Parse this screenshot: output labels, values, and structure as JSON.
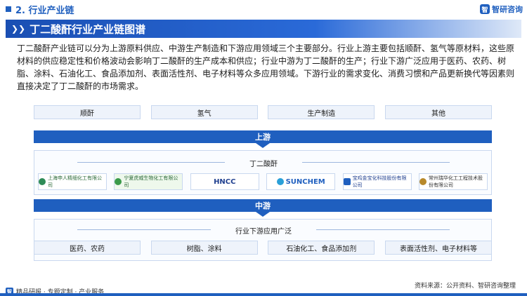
{
  "header": {
    "section": "2. 行业产业链",
    "brand": "智研咨询"
  },
  "title": "丁二酸酐行业产业链图谱",
  "intro": "丁二酸酐产业链可以分为上游原料供应、中游生产制造和下游应用领域三个主要部分。行业上游主要包括顺酐、氢气等原材料，这些原材料的供应稳定性和价格波动会影响丁二酸酐的生产成本和供应；行业中游为丁二酸酐的生产；行业下游广泛应用于医药、农药、树脂、涂料、石油化工、食品添加剂、表面活性剂、电子材料等众多应用领域。下游行业的需求变化、消费习惯和产品更新换代等因素则直接决定了丁二酸酐的市场需求。",
  "upstream": {
    "items": [
      "顺酐",
      "氢气",
      "生产制造",
      "其他"
    ],
    "band": "上游"
  },
  "midstream": {
    "label": "丁二酸酐",
    "companies": [
      {
        "name": "上海申人精细化工有限公司",
        "icon": "seal-icon"
      },
      {
        "name": "宁夏虎威生物化工有限公司",
        "icon": "seal-icon"
      },
      {
        "name": "HNCC",
        "icon": "wave-icon"
      },
      {
        "name": "SUNCHEM",
        "icon": "wave-icon"
      },
      {
        "name": "宝鸡金宝化科技股份有限公司",
        "icon": "shield-icon"
      },
      {
        "name": "常州瑞华化工工程技术股份有限公司",
        "icon": "seal-icon"
      }
    ],
    "band": "中游"
  },
  "downstream": {
    "label": "行业下游应用广泛",
    "items": [
      "医药、农药",
      "树脂、涂料",
      "石油化工、食品添加剂",
      "表面活性剂、电子材料等"
    ]
  },
  "footer": {
    "left": "精品研报 · 专题定制 · 产业服务",
    "source": "资料来源：公开资料、智研咨询整理"
  },
  "colors": {
    "accent": "#1f5fbf",
    "cell_bg": "#eef3fb"
  }
}
